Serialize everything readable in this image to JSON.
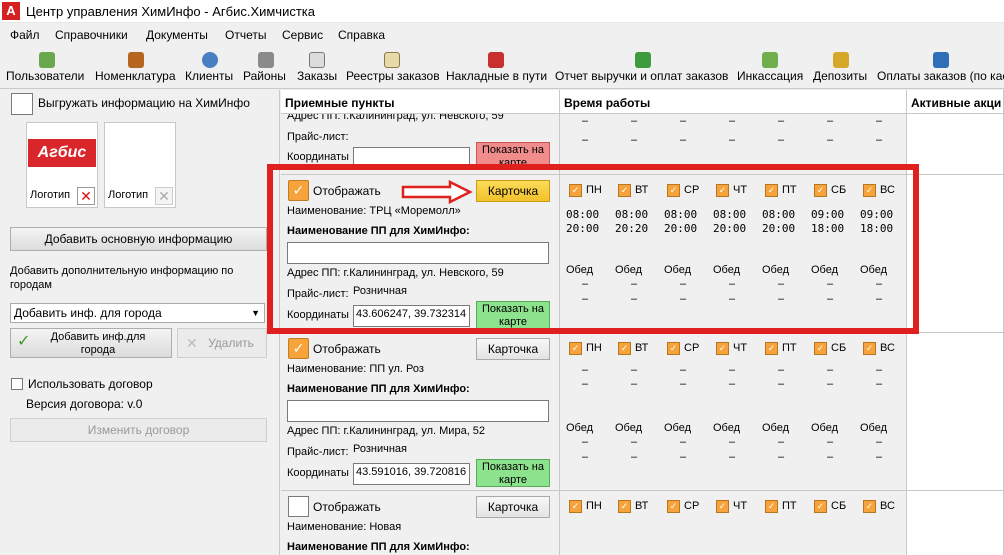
{
  "window": {
    "title": "Центр управления ХимИнфо - Агбис.Химчистка"
  },
  "menu": [
    "Файл",
    "Справочники",
    "Документы",
    "Отчеты",
    "Сервис",
    "Справка"
  ],
  "toolbar": [
    {
      "label": "Пользователи",
      "icon": "users-icon"
    },
    {
      "label": "Номенклатура",
      "icon": "items-icon"
    },
    {
      "label": "Клиенты",
      "icon": "client-icon"
    },
    {
      "label": "Районы",
      "icon": "districts-icon"
    },
    {
      "label": "Заказы",
      "icon": "orders-icon"
    },
    {
      "label": "Реестры заказов",
      "icon": "registers-icon"
    },
    {
      "label": "Накладные в пути",
      "icon": "truck-icon"
    },
    {
      "label": "Отчет выручки и оплат заказов",
      "icon": "books-icon"
    },
    {
      "label": "Инкассация",
      "icon": "money-icon"
    },
    {
      "label": "Депозиты",
      "icon": "deposit-icon"
    },
    {
      "label": "Оплаты заказов (по кас",
      "icon": "payment-icon"
    }
  ],
  "left": {
    "export_label": "Выгружать информацию на ХимИнфо",
    "logo_text": "Агбис",
    "logo1_label": "Логотип",
    "logo2_label": "Логотип",
    "add_main_info": "Добавить основную информацию",
    "add_extra_info_label": "Добавить дополнительную информацию по городам",
    "city_select": "Добавить инф. для города",
    "add_city_info": "Добавить инф.для города",
    "delete": "Удалить",
    "use_contract": "Использовать договор",
    "contract_version": "Версия договора: v.0",
    "change_contract": "Изменить договор"
  },
  "grid": {
    "headers": {
      "points": "Приемные пункты",
      "hours": "Время работы",
      "actions": "Активные акци"
    },
    "days": [
      "ПН",
      "ВТ",
      "СР",
      "ЧТ",
      "ПТ",
      "СБ",
      "ВС"
    ],
    "partial": {
      "address": "Адрес ПП: г.Калининград, ул. Невского, 59",
      "price_label": "Прайс-лист:",
      "coords_label": "Координаты",
      "map_btn": "Показать на карте",
      "dash": "–"
    },
    "rows": [
      {
        "show_label": "Отображать",
        "card_btn": "Карточка",
        "name": "Наименование: ТРЦ «Моремолл»",
        "name_hi_label": "Наименование ПП для ХимИнфо:",
        "address": "Адрес ПП: г.Калининград, ул. Невского, 59",
        "price_label": "Прайс-лист:",
        "price_value": "Розничная",
        "coords_label": "Координаты",
        "coords_value": "43.606247, 39.732314",
        "map_btn": "Показать на карте",
        "open": [
          "08:00",
          "08:00",
          "08:00",
          "08:00",
          "08:00",
          "09:00",
          "09:00"
        ],
        "close": [
          "20:00",
          "20:20",
          "20:00",
          "20:00",
          "20:00",
          "18:00",
          "18:00"
        ],
        "lunch": "Обед",
        "dash": "–"
      },
      {
        "show_label": "Отображать",
        "card_btn": "Карточка",
        "name": "Наименование: ПП ул. Роз",
        "name_hi_label": "Наименование ПП для ХимИнфо:",
        "address": "Адрес ПП: г.Калининград, ул. Мира, 52",
        "price_label": "Прайс-лист:",
        "price_value": "Розничная",
        "coords_label": "Координаты",
        "coords_value": "43.591016, 39.720816",
        "map_btn": "Показать на карте",
        "lunch": "Обед",
        "dash": "–"
      },
      {
        "show_label": "Отображать",
        "card_btn": "Карточка",
        "name": "Наименование: Новая",
        "name_hi_label": "Наименование ПП для ХимИнфо:"
      }
    ]
  },
  "colors": {
    "accent_orange": "#f5a33a",
    "highlight_red": "#e0201f",
    "map_btn_green": "#8de28d",
    "map_btn_red": "#f08c8c",
    "card_btn_yellow": "#f7cf3b"
  }
}
